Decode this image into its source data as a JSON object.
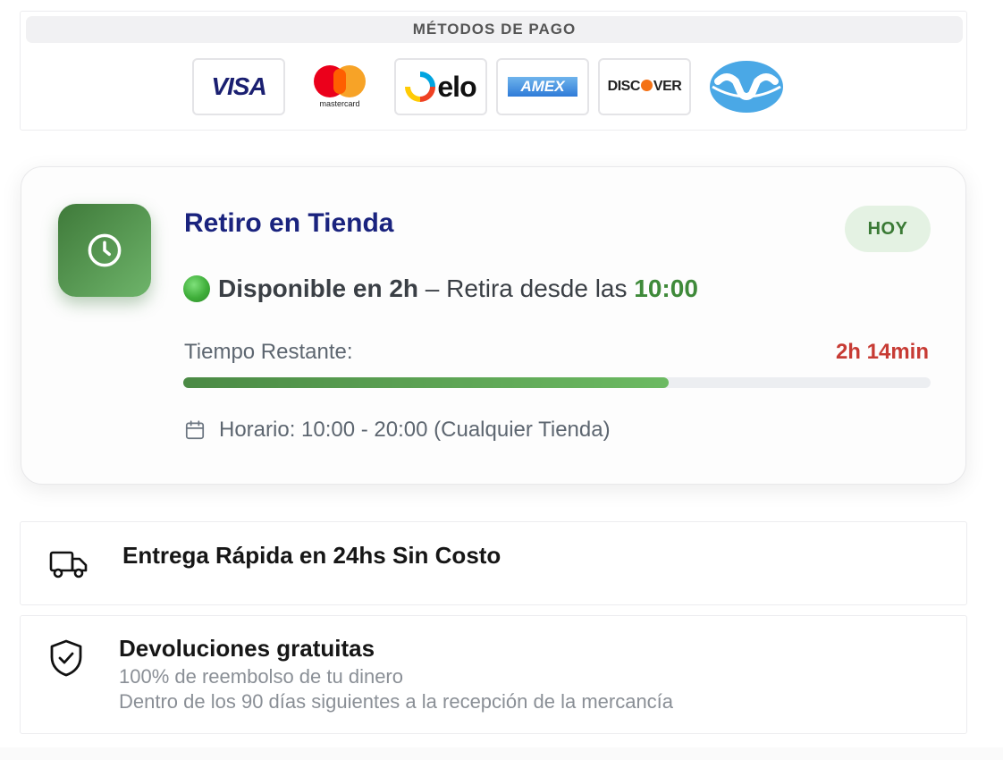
{
  "payment": {
    "header": "MÉTODOS DE PAGO",
    "methods": [
      {
        "name": "visa",
        "label": "VISA",
        "color": "#1a1f71"
      },
      {
        "name": "mastercard",
        "label": "mastercard"
      },
      {
        "name": "elo",
        "label": "elo"
      },
      {
        "name": "amex",
        "label": "AMEX"
      },
      {
        "name": "discover",
        "label_pre": "DISC",
        "label_post": "VER"
      },
      {
        "name": "mercadopago",
        "icon": "mercadopago-handshake-logo"
      }
    ]
  },
  "pickup": {
    "icon": "clock-icon",
    "title": "Retiro en Tienda",
    "badge": "HOY",
    "status_dot_color": "#3fae3a",
    "available_strong": "Disponible en 2h",
    "available_rest": " – Retira desde las ",
    "available_time": "10:00",
    "remaining_label": "Tiempo Restante:",
    "remaining_value": "2h 14min",
    "progress_fraction": 0.65,
    "hours_icon": "calendar-icon",
    "hours_text": "Horario: 10:00 - 20:00 (Cualquier Tienda)",
    "colors": {
      "title": "#1a237e",
      "accent_green": "#3f8a3a",
      "remaining_red": "#c73b34"
    }
  },
  "delivery": {
    "icon": "truck-icon",
    "title": "Entrega Rápida en 24hs Sin Costo"
  },
  "returns": {
    "icon": "shield-check-icon",
    "title": "Devoluciones gratuitas",
    "line1": "100% de reembolso de tu dinero",
    "line2": "Dentro de los 90 días siguientes a la recepción de la mercancía"
  }
}
